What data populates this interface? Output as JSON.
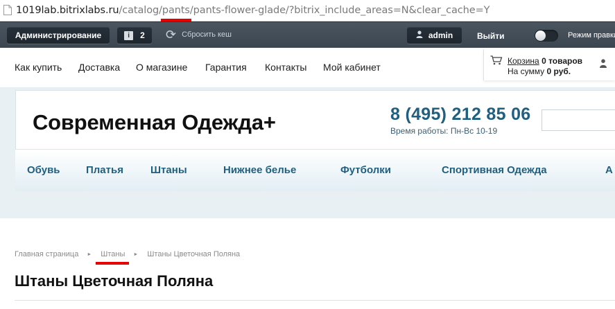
{
  "browser": {
    "url_host": "1019lab.bitrixlabs.ru",
    "url_before": "/catalog/",
    "url_highlight": "pants",
    "url_after": "/pants-flower-glade/?bitrix_include_areas=N&clear_cache=Y"
  },
  "admin_panel": {
    "admin_label": "Администрирование",
    "notifications_count": "2",
    "clear_cache_label": "Сбросить кеш",
    "user_label": "admin",
    "logout_label": "Выйти",
    "edit_mode_label": "Режим правки"
  },
  "top_menu": [
    "Как купить",
    "Доставка",
    "О магазине",
    "Гарантия",
    "Контакты",
    "Мой кабинет"
  ],
  "cart": {
    "cart_link": "Корзина",
    "items_count": "0 товаров",
    "sum_prefix": "На сумму",
    "sum_value": "0 руб."
  },
  "header": {
    "site_name": "Современная Одежда+",
    "phone": "8 (495) 212 85 06",
    "work_hours": "Время работы: Пн-Вс 10-19"
  },
  "catalog_menu": [
    "Обувь",
    "Платья",
    "Штаны",
    "Нижнее белье",
    "Футболки",
    "Спортивная Одежда",
    "А"
  ],
  "breadcrumb": {
    "items": [
      "Главная страница",
      "Штаны",
      "Штаны Цветочная Поляна"
    ],
    "separator": "►"
  },
  "page_title": "Штаны Цветочная Поляна",
  "colors": {
    "accent_blue": "#1f5f80",
    "highlight_red": "#e60000",
    "admin_bar": "#3c4650"
  }
}
